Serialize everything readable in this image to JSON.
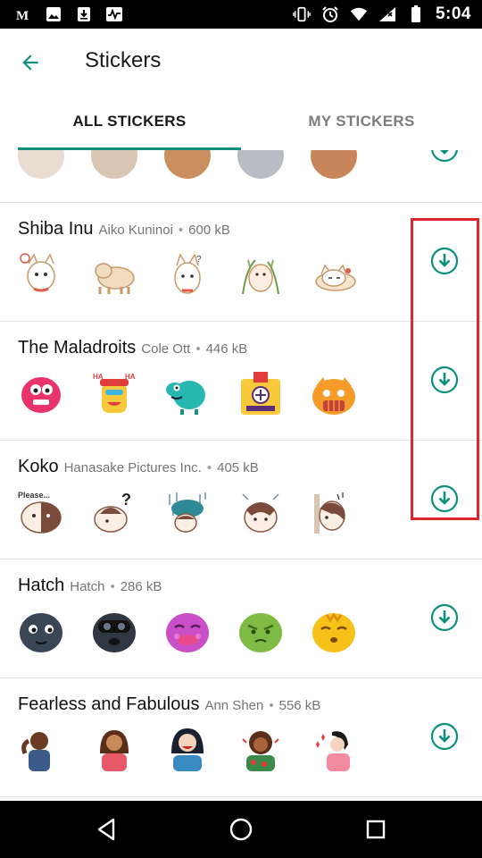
{
  "status_bar": {
    "time": "5:04",
    "left_icons": [
      "gmail-icon",
      "photo-icon",
      "download-notification-icon",
      "pulse-icon"
    ],
    "right_icons": [
      "vibrate-icon",
      "alarm-icon",
      "wifi-icon",
      "signal-icon",
      "battery-icon"
    ]
  },
  "app_bar": {
    "title": "Stickers",
    "back_icon": "arrow-left-icon",
    "accent_color": "#0c8f7b"
  },
  "tabs": [
    {
      "label": "ALL STICKERS",
      "selected": true
    },
    {
      "label": "MY STICKERS",
      "selected": false
    }
  ],
  "packs": [
    {
      "name": "Shiba Inu",
      "author": "Aiko Kuninoi",
      "separator": "•",
      "size": "600 kB"
    },
    {
      "name": "The Maladroits",
      "author": "Cole Ott",
      "separator": "•",
      "size": "446 kB"
    },
    {
      "name": "Koko",
      "author": "Hanasake Pictures Inc.",
      "separator": "•",
      "size": "405 kB"
    },
    {
      "name": "Hatch",
      "author": "Hatch",
      "separator": "•",
      "size": "286 kB"
    },
    {
      "name": "Fearless and Fabulous",
      "author": "Ann Shen",
      "separator": "•",
      "size": "556 kB"
    }
  ],
  "colors": {
    "highlight": "#e0242c",
    "download_icon": "#0c8f7b"
  },
  "nav_bar": {
    "icons": [
      "back-triangle-icon",
      "home-circle-icon",
      "recents-square-icon"
    ]
  }
}
